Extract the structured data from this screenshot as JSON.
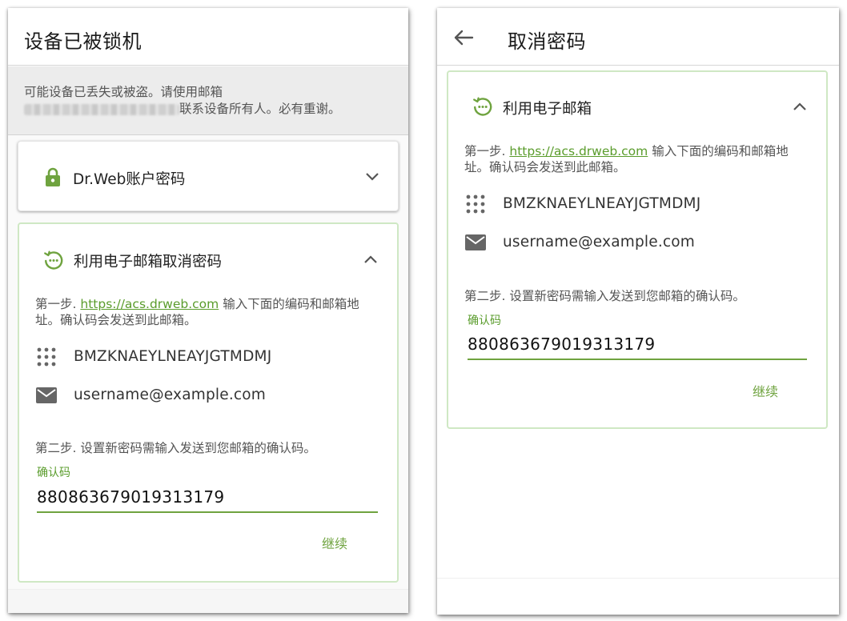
{
  "left": {
    "title": "设备已被锁机",
    "notice_line1": "可能设备已丢失或被盗。请使用邮箱",
    "notice_line2_suffix": "联系设备所有人。必有重谢。",
    "account_card": {
      "title": "Dr.Web账户密码"
    },
    "email_card": {
      "title": "利用电子邮箱取消密码",
      "step1_prefix": "第一步.",
      "step1_link": "https://acs.drweb.com",
      "step1_suffix_line1": "输入下面的编码和邮箱地",
      "step1_line2": "址。确认码会发送到此邮箱。",
      "code": "BMZKNAEYLNEAYJGTMDMJ",
      "email": "username@example.com",
      "step2": "第二步. 设置新密码需输入发送到您邮箱的确认码。",
      "field_label": "确认码",
      "field_value": "880863679019313179",
      "continue_label": "继续"
    }
  },
  "right": {
    "title": "取消密码",
    "email_card": {
      "title": "利用电子邮箱",
      "step1_prefix": "第一步.",
      "step1_link": "https://acs.drweb.com",
      "step1_suffix_line1": "输入下面的编码和邮箱地",
      "step1_line2": "址。确认码会发送到此邮箱。",
      "code": "BMZKNAEYLNEAYJGTMDMJ",
      "email": "username@example.com",
      "step2": "第二步. 设置新密码需输入发送到您邮箱的确认码。",
      "field_label": "确认码",
      "field_value": "880863679019313179",
      "continue_label": "继续"
    }
  },
  "colors": {
    "accent": "#6fa33f",
    "link": "#5a9c2c",
    "card_border": "#cfe8c4",
    "notice_bg": "#ececec"
  },
  "icons": {
    "back": "arrow-left-icon",
    "lock": "lock-icon",
    "restore": "restore-clock-icon",
    "chevron_down": "chevron-down-icon",
    "chevron_up": "chevron-up-icon",
    "dots_grid": "dots-grid-icon",
    "envelope": "envelope-icon"
  }
}
